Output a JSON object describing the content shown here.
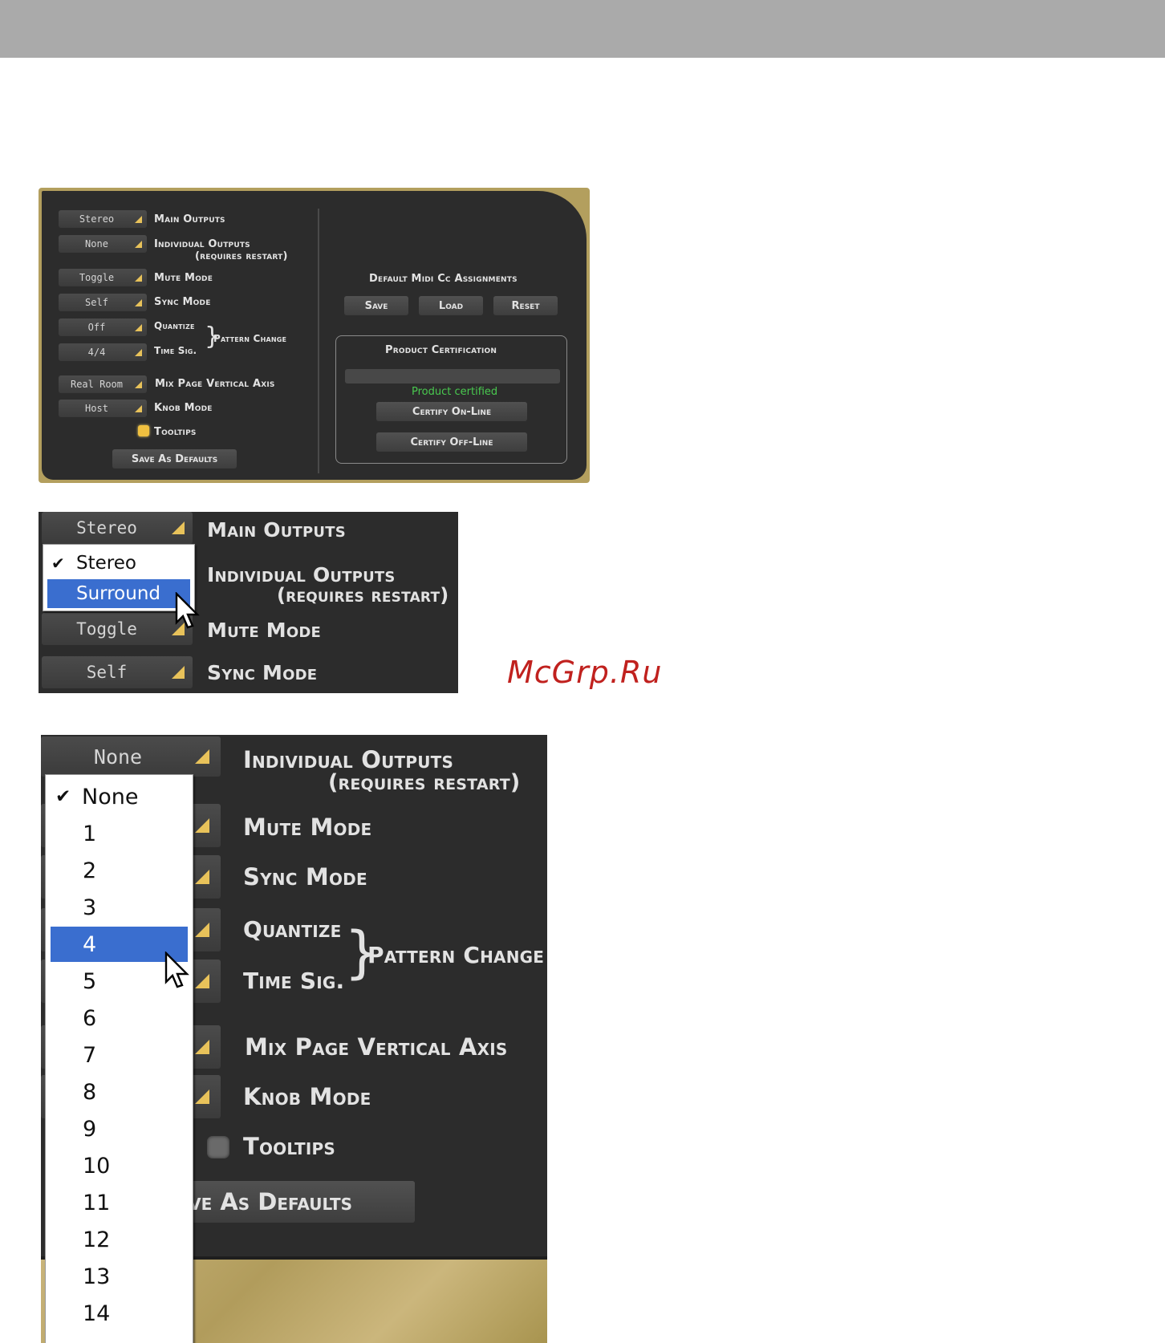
{
  "settings": {
    "main_outputs": {
      "value": "Stereo",
      "label": "Main Outputs"
    },
    "individual_outputs": {
      "value": "None",
      "label": "Individual Outputs",
      "note": "(requires restart)"
    },
    "mute_mode": {
      "value": "Toggle",
      "label": "Mute Mode"
    },
    "sync_mode": {
      "value": "Self",
      "label": "Sync Mode"
    },
    "quantize": {
      "value": "Off",
      "label": "Quantize"
    },
    "time_sig": {
      "value": "4/4",
      "label": "Time Sig."
    },
    "pattern_change": "Pattern Change",
    "mix_page": {
      "value": "Real Room",
      "label": "Mix Page Vertical Axis"
    },
    "knob_mode": {
      "value": "Host",
      "label": "Knob Mode"
    },
    "tooltips": {
      "label": "Tooltips"
    },
    "save_defaults": "Save As Defaults",
    "save_defaults_cropped": "ave As Defaults"
  },
  "midi": {
    "title": "Default Midi Cc Assignments",
    "save": "Save",
    "load": "Load",
    "reset": "Reset"
  },
  "certification": {
    "title": "Product Certification",
    "status": "Product certified",
    "online": "Certify On-Line",
    "offline": "Certify Off-Line"
  },
  "main_outputs_menu": {
    "items": [
      "Stereo",
      "Surround"
    ],
    "checked": "Stereo",
    "highlighted": "Surround",
    "check_mark": "✔"
  },
  "individual_outputs_menu": {
    "items": [
      "None",
      "1",
      "2",
      "3",
      "4",
      "5",
      "6",
      "7",
      "8",
      "9",
      "10",
      "11",
      "12",
      "13",
      "14"
    ],
    "checked": "None",
    "highlighted": "4",
    "check_mark": "✔"
  },
  "watermark": "McGrp.Ru",
  "colors": {
    "panel_bg": "#2c2c2c",
    "frame_gold": "#b39f5e",
    "accent_triangle": "#e8c25a",
    "certified_green": "#49c94f",
    "menu_highlight": "#3a6ecf",
    "tooltip_on": "#f0c040",
    "tooltip_off": "#6a6a6a"
  }
}
